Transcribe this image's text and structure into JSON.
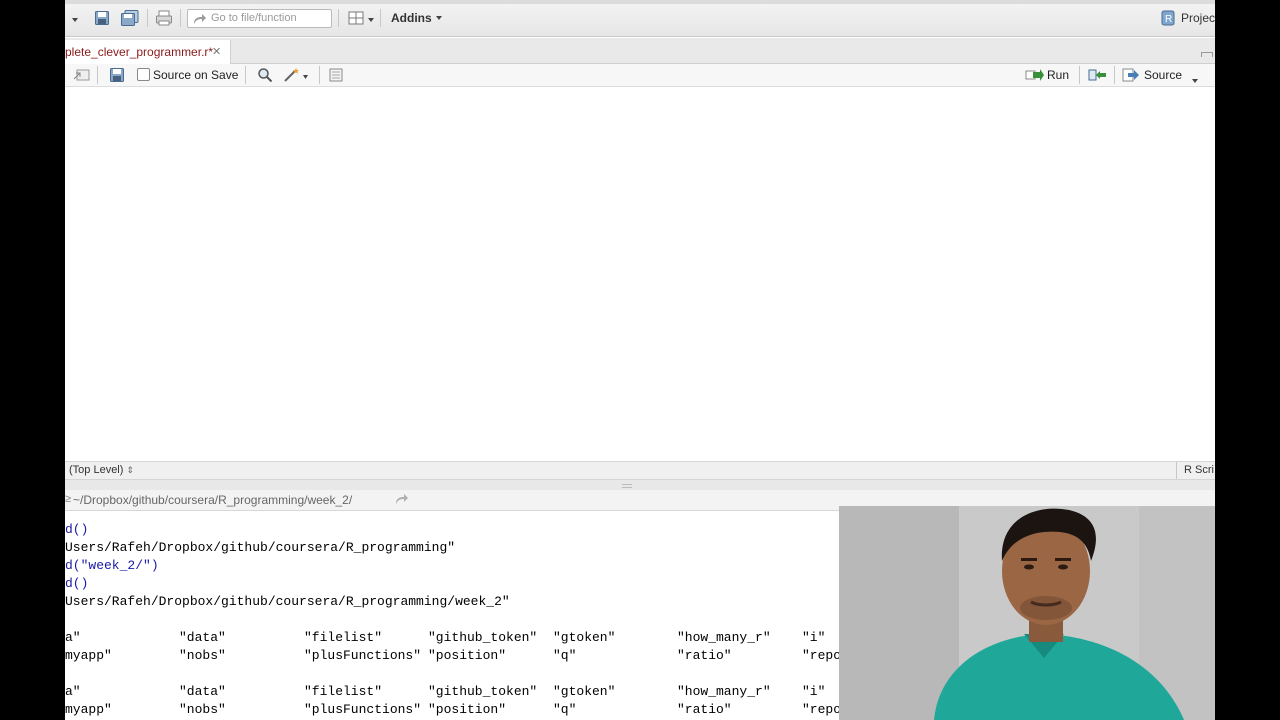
{
  "toolbar": {
    "goto_placeholder": "Go to file/function",
    "addins_label": "Addins",
    "project_label": "Projec"
  },
  "editor": {
    "tab_title": "plete_clever_programmer.r*",
    "source_on_save_label": "Source on Save",
    "run_label": "Run",
    "source_label": "Source",
    "status_scope": "(Top Level)",
    "status_type": "R Scri"
  },
  "console": {
    "path": "~/Dropbox/github/coursera/R_programming/week_2/",
    "lines": [
      {
        "text": "d()",
        "kind": "command"
      },
      {
        "text": "Users/Rafeh/Dropbox/github/coursera/R_programming\"",
        "kind": "output"
      },
      {
        "text": "d(\"week_2/\")",
        "kind": "command"
      },
      {
        "text": "d()",
        "kind": "command"
      },
      {
        "text": "Users/Rafeh/Dropbox/github/coursera/R_programming/week_2\"",
        "kind": "output"
      }
    ],
    "ls_rows": [
      [
        "a\"",
        "\"data\"",
        "\"filelist\"",
        "\"github_token\"",
        "\"gtoken\"",
        "\"how_many_r\"",
        "\"i\""
      ],
      [
        "myapp\"",
        "\"nobs\"",
        "\"plusFunctions\"",
        "\"position\"",
        "\"q\"",
        "\"ratio\"",
        "\"repo"
      ],
      [
        "a\"",
        "\"data\"",
        "\"filelist\"",
        "\"github_token\"",
        "\"gtoken\"",
        "\"how_many_r\"",
        "\"i\""
      ],
      [
        "myapp\"",
        "\"nobs\"",
        "\"plusFunctions\"",
        "\"position\"",
        "\"q\"",
        "\"ratio\"",
        "\"repo"
      ]
    ]
  },
  "colors": {
    "tab_title": "#8b1a1a",
    "console_command": "#1a1aa6",
    "webcam_shirt": "#1fa89a"
  },
  "icons": [
    "dropdown-arrow-icon",
    "save-icon",
    "save-all-icon",
    "print-icon",
    "goto-arrow-icon",
    "grid-icon",
    "caret-down-icon",
    "project-icon",
    "close-icon",
    "show-in-window-icon",
    "search-icon",
    "magic-wand-icon",
    "notebook-icon",
    "run-icon",
    "rerun-icon",
    "source-icon",
    "refresh-path-icon"
  ]
}
